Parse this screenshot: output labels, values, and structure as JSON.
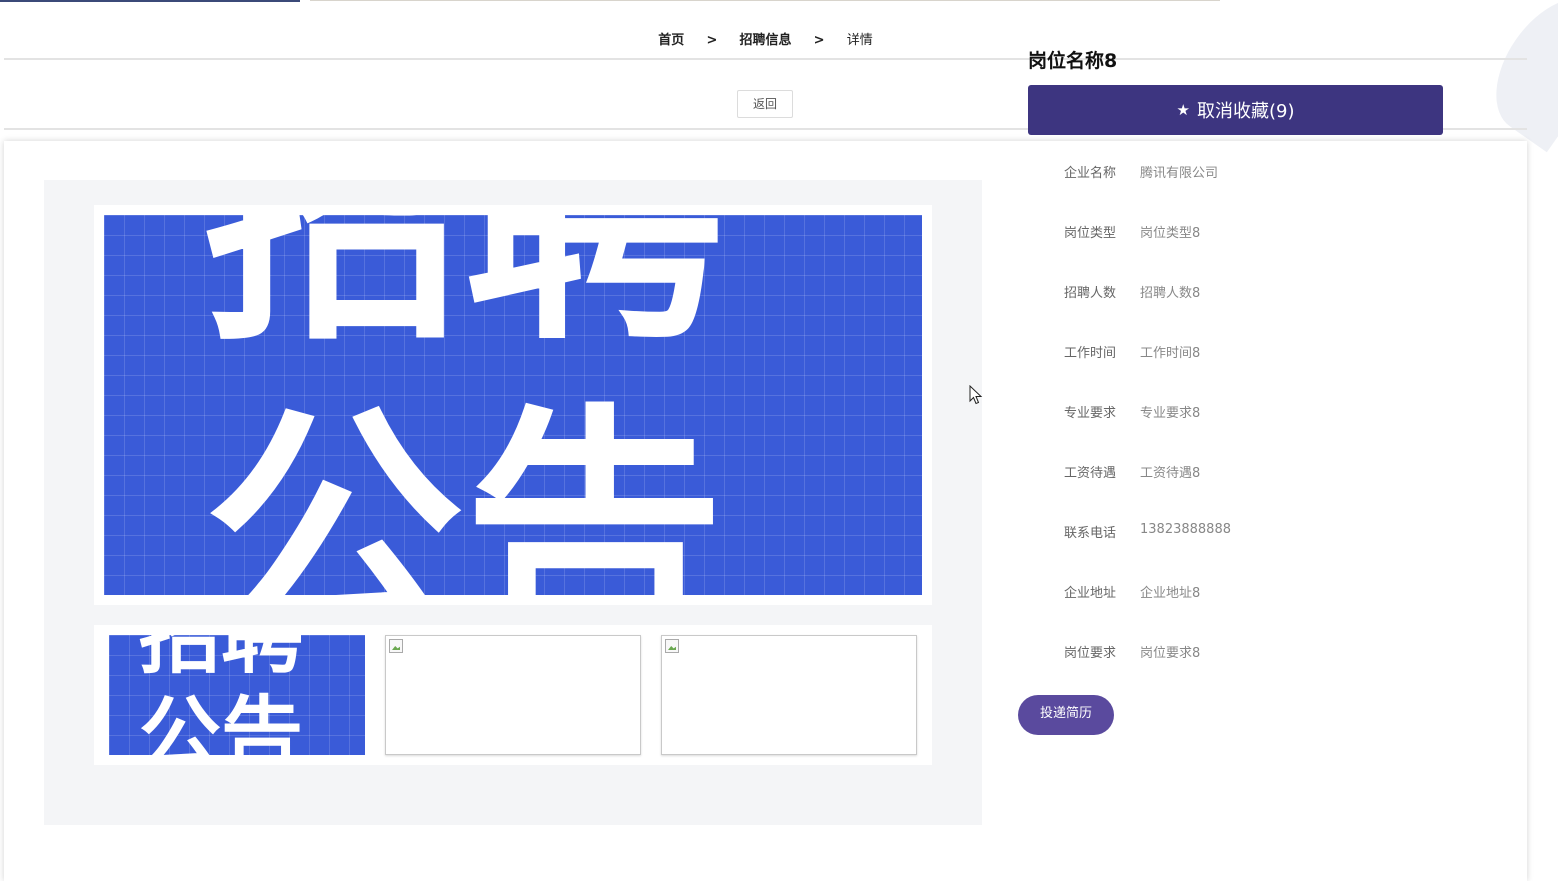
{
  "breadcrumb": {
    "home": "首页",
    "separator": ">",
    "section": "招聘信息",
    "current": "详情"
  },
  "back_button": "返回",
  "poster": {
    "line1": "招聘",
    "line2": "公告"
  },
  "job": {
    "title": "岗位名称8",
    "favorite_button": "取消收藏(9)",
    "fields": [
      {
        "label": "企业名称",
        "value": "腾讯有限公司"
      },
      {
        "label": "岗位类型",
        "value": "岗位类型8"
      },
      {
        "label": "招聘人数",
        "value": "招聘人数8"
      },
      {
        "label": "工作时间",
        "value": "工作时间8"
      },
      {
        "label": "专业要求",
        "value": "专业要求8"
      },
      {
        "label": "工资待遇",
        "value": "工资待遇8"
      },
      {
        "label": "联系电话",
        "value": "13823888888"
      },
      {
        "label": "企业地址",
        "value": "企业地址8"
      },
      {
        "label": "岗位要求",
        "value": "岗位要求8"
      }
    ],
    "apply_button": "投递简历"
  },
  "colors": {
    "accent": "#3d3580",
    "apply": "#5a4a9e",
    "poster_blue": "#3a5bd8"
  }
}
